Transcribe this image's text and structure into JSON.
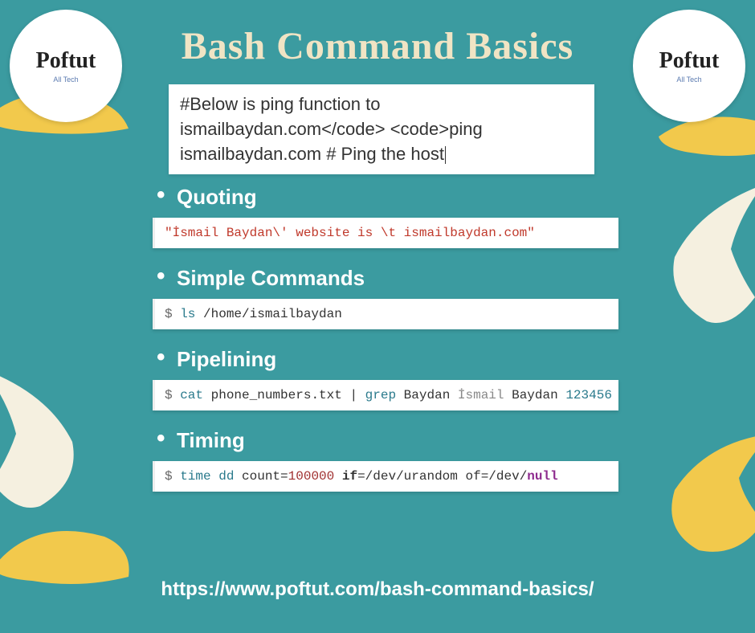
{
  "title": "Bash Command Basics",
  "logo": {
    "title": "Poftut",
    "subtitle": "All Tech"
  },
  "intro": {
    "line1": "#Below is ping function to",
    "line2": "ismailbaydan.com</code> <code>ping",
    "line3": "ismailbaydan.com  # Ping the host"
  },
  "sections": {
    "quoting": {
      "heading": "Quoting",
      "code": "\"İsmail Baydan\\' website is \\t ismailbaydan.com\""
    },
    "simple": {
      "heading": "Simple Commands",
      "prompt": "$ ",
      "cmd": "ls",
      "path": " /home/ismailbaydan"
    },
    "pipelining": {
      "heading": "Pipelining",
      "prompt": "$ ",
      "p1": "cat",
      "p2": " phone_numbers.txt ",
      "p3": "|",
      "p4": " grep",
      "p5": " Baydan ",
      "p6": "İsmail",
      "p7": " Baydan ",
      "p8": "123456"
    },
    "timing": {
      "heading": "Timing",
      "prompt": "$ ",
      "t1": "time",
      "t2": " dd",
      "t3": " count=",
      "t4": "100000",
      "t5": " ",
      "t6": "if",
      "t7": "=/dev/urandom of=/dev/",
      "t8": "null"
    }
  },
  "footer_url": "https://www.poftut.com/bash-command-basics/"
}
